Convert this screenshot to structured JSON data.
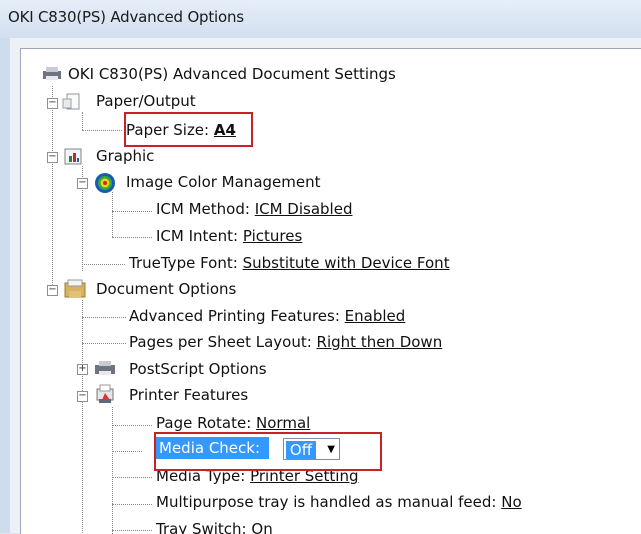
{
  "window": {
    "title": "OKI C830(PS) Advanced Options"
  },
  "tree": {
    "root": "OKI C830(PS) Advanced Document Settings",
    "paper_output": "Paper/Output",
    "paper_size": {
      "label": "Paper Size:",
      "value": "A4"
    },
    "graphic": "Graphic",
    "icm": "Image Color Management",
    "icm_method": {
      "label": "ICM Method:",
      "value": "ICM Disabled"
    },
    "icm_intent": {
      "label": "ICM Intent:",
      "value": "Pictures"
    },
    "truetype": {
      "label": "TrueType Font:",
      "value": "Substitute with Device Font"
    },
    "document_options": "Document Options",
    "adv_printing": {
      "label": "Advanced Printing Features:",
      "value": "Enabled"
    },
    "pages_layout": {
      "label": "Pages per Sheet Layout:",
      "value": "Right then Down"
    },
    "postscript": "PostScript Options",
    "printer_features": "Printer Features",
    "page_rotate": {
      "label": "Page Rotate:",
      "value": "Normal"
    },
    "media_check": {
      "label": "Media Check:",
      "value": "Off"
    },
    "media_type": {
      "label": "Media Type:",
      "value": "Printer Setting"
    },
    "multipurpose": {
      "label": "Multipurpose tray is handled as manual feed:",
      "value": "No"
    },
    "tray_switch": {
      "label": "Tray Switch:",
      "value": "On"
    },
    "expander_minus": "−",
    "expander_plus": "+"
  },
  "colors": {
    "highlight_box": "#c8212a",
    "selection": "#3399ff"
  }
}
